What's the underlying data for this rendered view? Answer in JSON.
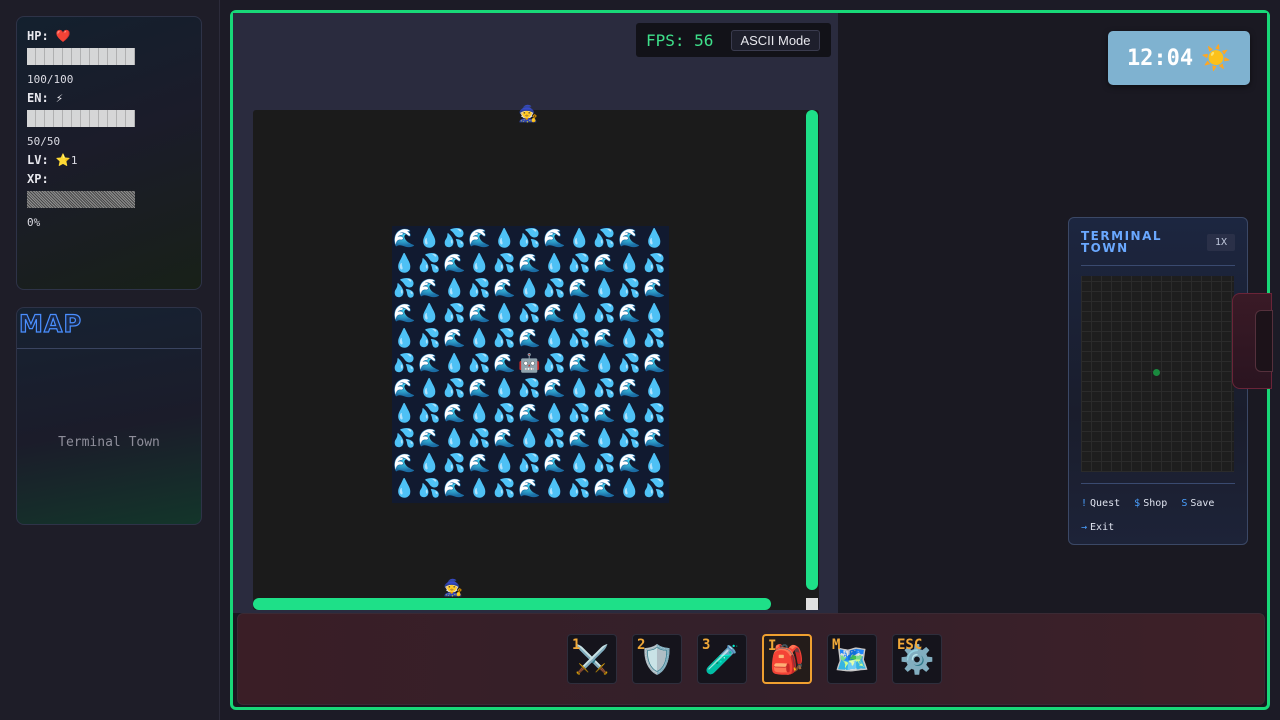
{
  "stats": {
    "hp_label": "HP:",
    "hp_icon": "❤️",
    "hp_value": "100/100",
    "en_label": "EN:",
    "en_icon": "⚡",
    "en_value": "50/50",
    "lv_label": "LV:",
    "lv_icon": "⭐",
    "lv_value": "1",
    "xp_label": "XP:",
    "xp_value": "0%",
    "hp_fill": 1.0,
    "en_fill": 1.0,
    "xp_fill": 0.0
  },
  "map_panel": {
    "title": "MAP",
    "location": "Terminal Town"
  },
  "hud": {
    "fps_text": "FPS: 56",
    "ascii_mode_label": "ASCII Mode",
    "clock_time": "12:04",
    "clock_icon": "☀️"
  },
  "game": {
    "top_sprite": "🧙",
    "bottom_sprite": "🧙",
    "center_sprite": "🤖",
    "water_tiles": [
      "🌊",
      "💧",
      "💦"
    ],
    "water_grid_size": 11
  },
  "town_card": {
    "title": "TERMINAL TOWN",
    "zoom": "1X",
    "legend": [
      {
        "key": "!",
        "label": "Quest"
      },
      {
        "key": "$",
        "label": "Shop"
      },
      {
        "key": "S",
        "label": "Save"
      },
      {
        "key": "→",
        "label": "Exit"
      }
    ]
  },
  "hotbar": {
    "slots": [
      {
        "key": "1",
        "icon": "⚔️",
        "name": "sword"
      },
      {
        "key": "2",
        "icon": "🛡️",
        "name": "shield"
      },
      {
        "key": "3",
        "icon": "🧪",
        "name": "potion"
      },
      {
        "key": "I",
        "icon": "🎒",
        "name": "inventory",
        "active": true
      },
      {
        "key": "M",
        "icon": "🗺️",
        "name": "map"
      },
      {
        "key": "ESC",
        "icon": "⚙️",
        "name": "settings"
      }
    ]
  },
  "colors": {
    "accent": "#18d878",
    "hotkey": "#f0a838",
    "map_title": "#4a8fff"
  }
}
